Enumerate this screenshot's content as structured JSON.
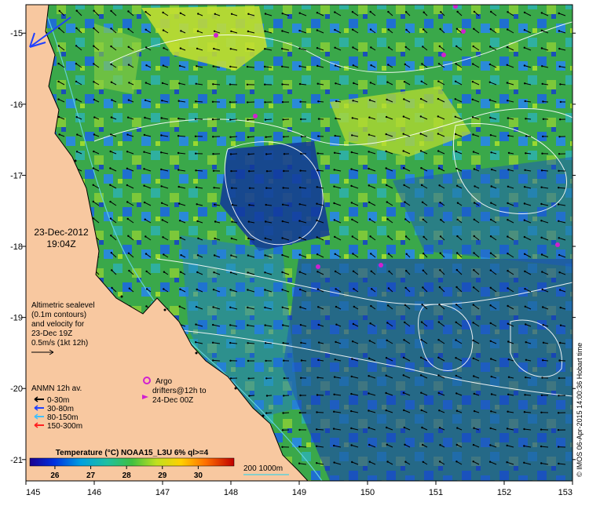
{
  "map": {
    "x_ticks": [
      "145",
      "146",
      "147",
      "148",
      "149",
      "150",
      "151",
      "152",
      "153"
    ],
    "y_ticks": [
      "-15",
      "-16",
      "-17",
      "-18",
      "-19",
      "-20",
      "-21"
    ],
    "xlim": [
      145,
      153
    ],
    "ylim": [
      -21.3,
      -14.6
    ],
    "colors": {
      "land": "#f8c8a0",
      "coast": "#000000",
      "contour": "#ffffff",
      "shelf": "#60d0d8",
      "argo": "#d020d0"
    }
  },
  "timestamp": {
    "date": "23-Dec-2012",
    "time": "19:04Z"
  },
  "altimetry_note": {
    "lines": [
      "Altimetric sealevel",
      "(0.1m contours)",
      "and velocity for",
      "23-Dec 19Z",
      "0.5m/s (1kt 12h)"
    ]
  },
  "anmn": {
    "title": "ANMN 12h av.",
    "items": [
      {
        "label": "0-30m",
        "color": "#000000"
      },
      {
        "label": "30-80m",
        "color": "#2040ff"
      },
      {
        "label": "80-150m",
        "color": "#40c0ff"
      },
      {
        "label": "150-300m",
        "color": "#ff2020"
      }
    ]
  },
  "argo": {
    "label": "Argo",
    "drifters_line1": "drifters@12h to",
    "drifters_line2": "24-Dec 00Z"
  },
  "colorbar": {
    "title": "Temperature (°C) NOAA15_L3U 6% ql>=4",
    "ticks": [
      "26",
      "27",
      "28",
      "29",
      "30"
    ],
    "tick_values": [
      26,
      27,
      28,
      29,
      30
    ],
    "range": [
      25.3,
      31.0
    ]
  },
  "bathy_legend": {
    "label": "200  1000m"
  },
  "credit": "© IMOS 06-Apr-2015 14:00:36 Hobart time"
}
